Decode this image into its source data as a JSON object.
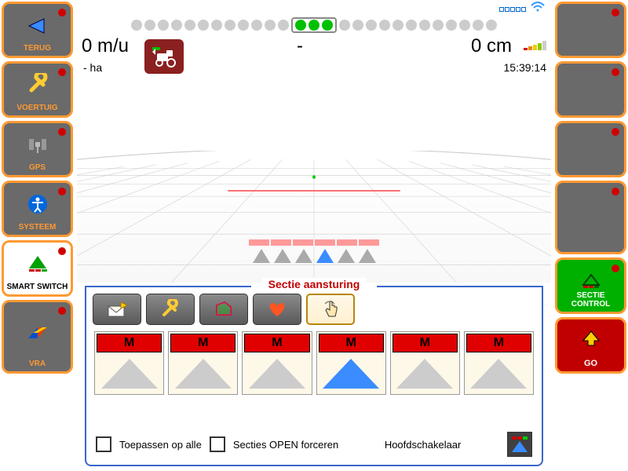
{
  "left_buttons": [
    {
      "label": "TERUG",
      "icon": "back"
    },
    {
      "label": "VOERTUIG",
      "icon": "wrench"
    },
    {
      "label": "GPS",
      "icon": "satellite"
    },
    {
      "label": "SYSTEEM",
      "icon": "accessibility"
    },
    {
      "label": "SMART SWITCH",
      "icon": "smartswitch",
      "white": true
    },
    {
      "label": "VRA",
      "icon": "vra",
      "last": true
    }
  ],
  "right_buttons": [
    {
      "label": ""
    },
    {
      "label": ""
    },
    {
      "label": ""
    },
    {
      "label": ""
    },
    {
      "label": "SECTIE CONTROL",
      "green": true,
      "icon": "sectie"
    },
    {
      "label": "GO",
      "red": true,
      "icon": "go"
    }
  ],
  "top": {
    "speed": "0 m/u",
    "offset": "0 cm",
    "area": "- ha",
    "dash": "-",
    "time": "15:39:14",
    "square_ind": "□□□□□"
  },
  "panel": {
    "title": "Sectie aansturing",
    "sections": [
      "M",
      "M",
      "M",
      "M",
      "M",
      "M"
    ],
    "blue_idx": 3,
    "apply_all": "Toepassen op alle",
    "force_open": "Secties OPEN forceren",
    "master": "Hoofdschakelaar"
  }
}
